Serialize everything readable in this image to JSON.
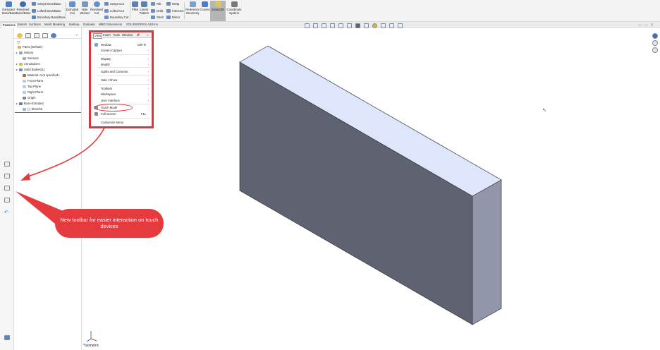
{
  "ribbon": {
    "buttons": [
      {
        "label": "Extruded\nBoss/Base",
        "icon": "extruded-boss-icon"
      },
      {
        "label": "Revolved\nBoss/Base",
        "icon": "revolved-boss-icon"
      },
      {
        "label": "Extruded\nCut",
        "icon": "extruded-cut-icon"
      },
      {
        "label": "Hole\nWizard",
        "icon": "hole-wizard-icon"
      },
      {
        "label": "Revolved\nCut",
        "icon": "revolved-cut-icon"
      },
      {
        "label": "Fillet",
        "icon": "fillet-icon"
      },
      {
        "label": "Linear\nPattern",
        "icon": "linear-pattern-icon"
      },
      {
        "label": "Reference\nGeometry",
        "icon": "reference-geometry-icon"
      },
      {
        "label": "Curves",
        "icon": "curves-icon"
      },
      {
        "label": "Instant3D",
        "icon": "instant3d-icon"
      },
      {
        "label": "Coordinate\nSystem",
        "icon": "coordinate-system-icon"
      }
    ],
    "small": [
      "Swept Boss/Base",
      "Lofted Boss/Base",
      "Boundary Boss/Base",
      "Swept Cut",
      "Lofted Cut",
      "Boundary Cut",
      "Rib",
      "Draft",
      "Shell",
      "Wrap",
      "Intersect",
      "Mirror"
    ]
  },
  "tabs": [
    "Features",
    "Sketch",
    "Surfaces",
    "Mesh Modeling",
    "Markup",
    "Evaluate",
    "MBD Dimensions",
    "SOLIDWORKS Add-Ins"
  ],
  "tree": [
    {
      "label": "Part1 (Default)",
      "expander": "",
      "icon": "part-icon"
    },
    {
      "label": "History",
      "expander": "▸",
      "icon": "history-icon"
    },
    {
      "label": "Sensors",
      "expander": "",
      "icon": "sensors-icon"
    },
    {
      "label": "Annotations",
      "expander": "▸",
      "icon": "annotations-icon"
    },
    {
      "label": "Solid Bodies(1)",
      "expander": "▸",
      "icon": "solid-bodies-icon"
    },
    {
      "label": "Material <not specified>",
      "expander": "",
      "icon": "material-icon"
    },
    {
      "label": "Front Plane",
      "expander": "",
      "icon": "plane-icon"
    },
    {
      "label": "Top Plane",
      "expander": "",
      "icon": "plane-icon"
    },
    {
      "label": "Right Plane",
      "expander": "",
      "icon": "plane-icon"
    },
    {
      "label": "Origin",
      "expander": "",
      "icon": "origin-icon"
    },
    {
      "label": "Boss-Extrude1",
      "expander": "▸",
      "icon": "boss-extrude-icon"
    },
    {
      "label": "(-) Sketch2",
      "expander": "",
      "icon": "sketch-icon"
    }
  ],
  "menu": {
    "bar": [
      "View",
      "Insert",
      "Tools",
      "Window"
    ],
    "items": [
      {
        "label": "Redraw",
        "shortcut": "Ctrl+R",
        "arrow": "",
        "icon": "redraw-icon"
      },
      {
        "label": "Screen Capture",
        "shortcut": "",
        "arrow": "›",
        "icon": ""
      },
      {
        "label": "Display",
        "shortcut": "",
        "arrow": "›",
        "icon": ""
      },
      {
        "label": "Modify",
        "shortcut": "",
        "arrow": "›",
        "icon": ""
      },
      {
        "label": "Lights and Cameras",
        "shortcut": "",
        "arrow": "›",
        "icon": ""
      },
      {
        "label": "Hide / Show",
        "shortcut": "",
        "arrow": "›",
        "icon": ""
      },
      {
        "label": "Toolbars",
        "shortcut": "",
        "arrow": "›",
        "icon": ""
      },
      {
        "label": "Workspace",
        "shortcut": "",
        "arrow": "›",
        "icon": ""
      },
      {
        "label": "User Interface",
        "shortcut": "",
        "arrow": "›",
        "icon": ""
      },
      {
        "label": "Touch Mode",
        "shortcut": "",
        "arrow": "",
        "icon": "touch-mode-icon"
      },
      {
        "label": "Full Screen",
        "shortcut": "F11",
        "arrow": "",
        "icon": "full-screen-icon"
      },
      {
        "label": "Customize Menu",
        "shortcut": "",
        "arrow": "",
        "icon": ""
      }
    ]
  },
  "callout": {
    "text": "New toolbar for easier interaction on touch devices"
  },
  "viewport": {
    "model_name": "*Isometric"
  },
  "colors": {
    "accent": "#e53b3f",
    "box_front": "#5f6270",
    "box_top": "#dde6fb",
    "box_side": "#9296ab"
  }
}
